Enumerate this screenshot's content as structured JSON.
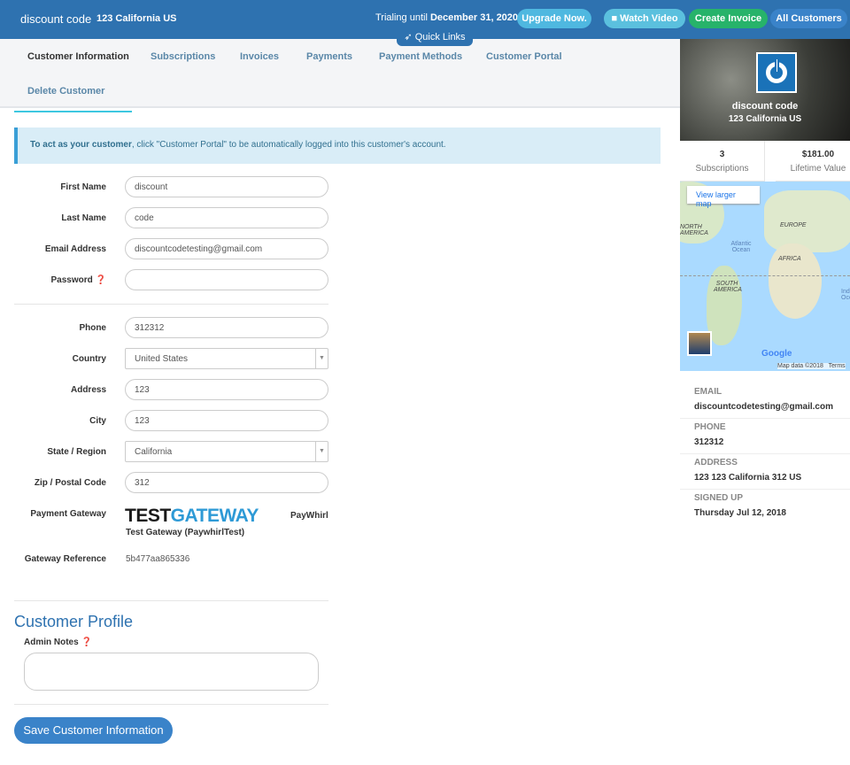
{
  "header": {
    "customer_name": "discount code",
    "customer_address": "123 California US",
    "trial_prefix": "Trialing until",
    "trial_date": "December 31, 2020",
    "upgrade": "Upgrade Now.",
    "watch_video": "Watch Video",
    "create_invoice": "Create Invoice",
    "all_customers": "All Customers",
    "quick_links": "Quick Links"
  },
  "tabs": [
    "Customer Information",
    "Subscriptions",
    "Invoices",
    "Payments",
    "Payment Methods",
    "Customer Portal",
    "Delete Customer"
  ],
  "alert": {
    "bold": "To act as your customer",
    "text": ", click \"Customer Portal\" to be automatically logged into this customer's account."
  },
  "form": {
    "first_name_label": "First Name",
    "first_name": "discount",
    "last_name_label": "Last Name",
    "last_name": "code",
    "email_label": "Email Address",
    "email": "discountcodetesting@gmail.com",
    "password_label": "Password",
    "password": "",
    "phone_label": "Phone",
    "phone": "312312",
    "country_label": "Country",
    "country": "United States",
    "address_label": "Address",
    "address": "123",
    "city_label": "City",
    "city": "123",
    "state_label": "State / Region",
    "state": "California",
    "zip_label": "Zip / Postal Code",
    "zip": "312",
    "gateway_label": "Payment Gateway",
    "gateway_logo_test": "TEST",
    "gateway_logo_gateway": "GATEWAY",
    "gateway_brand": "PayWhirl",
    "gateway_name": "Test Gateway (PaywhirlTest)",
    "gateway_ref_label": "Gateway Reference",
    "gateway_ref": "5b477aa865336"
  },
  "profile": {
    "title": "Customer Profile",
    "admin_notes_label": "Admin Notes",
    "admin_notes": "",
    "save": "Save Customer Information"
  },
  "sidebar": {
    "name": "discount code",
    "address": "123 California US",
    "subscriptions_count": "3",
    "subscriptions_label": "Subscriptions",
    "lifetime_value": "$181.00",
    "lifetime_label": "Lifetime Value",
    "map": {
      "view_larger": "View larger map",
      "north_america": "NORTH AMERICA",
      "atlantic": "Atlantic Ocean",
      "europe": "EUROPE",
      "africa": "AFRICA",
      "south_america": "SOUTH AMERICA",
      "indian": "Indian Ocean",
      "google": "Google",
      "map_data": "Map data ©2018",
      "terms": "Terms"
    },
    "email_label": "EMAIL",
    "email": "discountcodetesting@gmail.com",
    "phone_label": "PHONE",
    "phone": "312312",
    "address_label": "ADDRESS",
    "address_full": "123 123 California 312 US",
    "signed_label": "SIGNED UP",
    "signed": "Thursday Jul 12, 2018"
  },
  "colors": {
    "header": "#2e72b0",
    "upgrade": "#4fb8e0",
    "watch": "#5bc0de",
    "create": "#27b36a",
    "all": "#3a83c9",
    "accent": "#3dc7e0"
  }
}
